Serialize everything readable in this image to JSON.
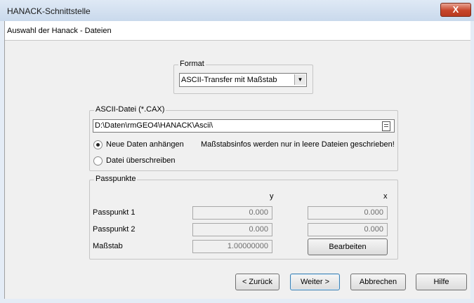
{
  "window": {
    "title": "HANACK-Schnittstelle",
    "close_glyph": "X"
  },
  "header": {
    "label": "Auswahl der Hanack - Dateien"
  },
  "format": {
    "legend": "Format",
    "selected": "ASCII-Transfer mit Maßstab",
    "arrow_glyph": "▼"
  },
  "ascii": {
    "legend": "ASCII-Datei (*.CAX)",
    "path": "D:\\Daten\\rmGEO4\\HANACK\\Ascii\\",
    "option_append": "Neue Daten anhängen",
    "option_overwrite": "Datei überschreiben",
    "selected_option": "append",
    "info": "Maßstabsinfos werden nur in leere Dateien geschrieben!"
  },
  "passpunkte": {
    "legend": "Passpunkte",
    "col_y": "y",
    "col_x": "x",
    "rows": [
      {
        "label": "Passpunkt 1",
        "y": "0.000",
        "x": "0.000"
      },
      {
        "label": "Passpunkt 2",
        "y": "0.000",
        "x": "0.000"
      }
    ],
    "scale_label": "Maßstab",
    "scale_value": "1.00000000",
    "edit_button": "Bearbeiten"
  },
  "footer": {
    "back": "< Zurück",
    "next": "Weiter >",
    "cancel": "Abbrechen",
    "help": "Hilfe"
  }
}
